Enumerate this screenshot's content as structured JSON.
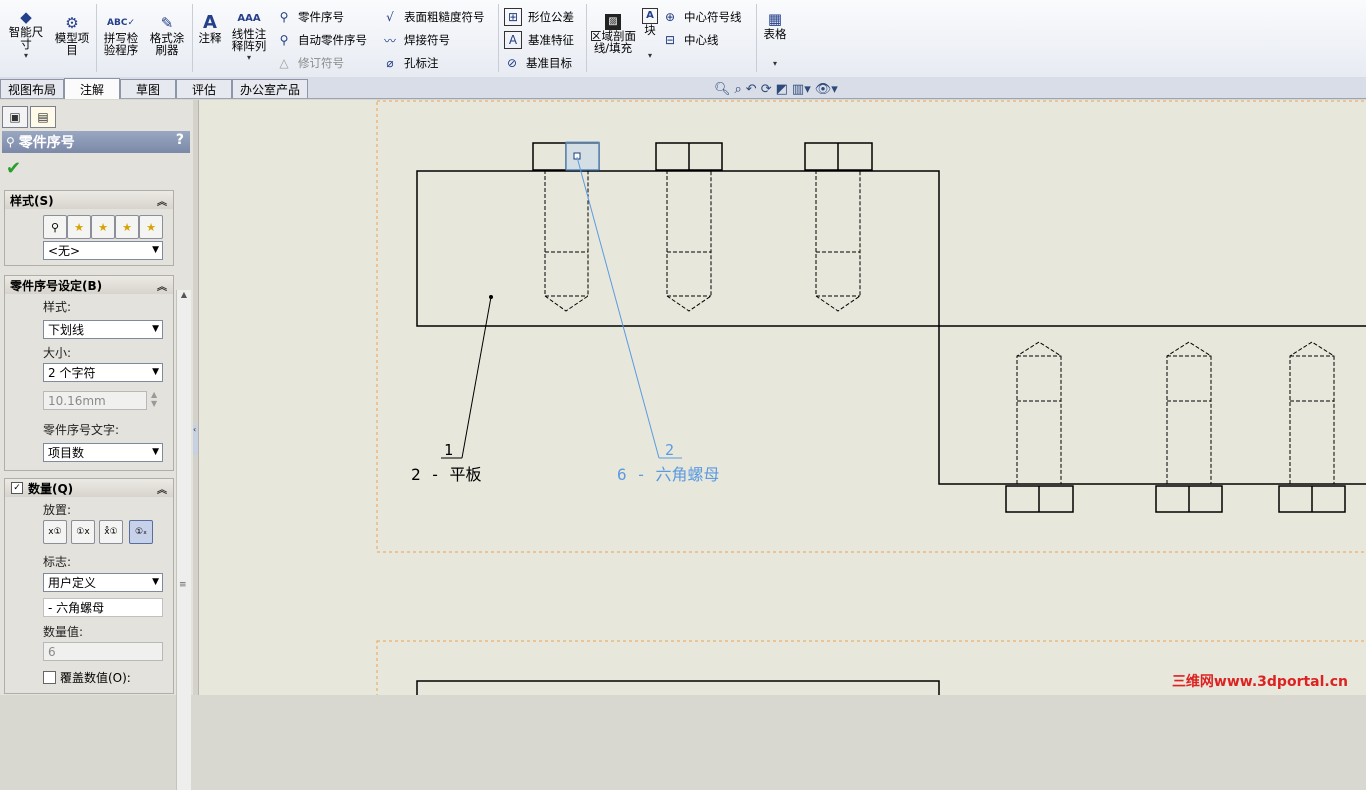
{
  "ribbon": {
    "smart_dim": "智能尺寸",
    "model_items": "模型项目",
    "spell_check": "拼写检验程序",
    "format_painter": "格式涂刷器",
    "note": "注释",
    "linear_pattern": "线性注释阵列",
    "balloon": "零件序号",
    "auto_balloon": "自动零件序号",
    "revision_symbol": "修订符号",
    "surface_finish": "表面粗糙度符号",
    "weld_symbol": "焊接符号",
    "hole_callout": "孔标注",
    "gdt": "形位公差",
    "datum_feature": "基准特征",
    "datum_target": "基准目标",
    "area_hatch": "区域剖面线/填充",
    "block": "块",
    "center_mark": "中心符号线",
    "centerline": "中心线",
    "table": "表格"
  },
  "tabs": [
    "视图布局",
    "注解",
    "草图",
    "评估",
    "办公室产品"
  ],
  "active_tab": "注解",
  "panel": {
    "title": "零件序号",
    "help": "?",
    "style_group": {
      "title": "样式(S)",
      "combo": "<无>"
    },
    "balloon_settings": {
      "title": "零件序号设定(B)",
      "style_label": "样式:",
      "style_value": "下划线",
      "size_label": "大小:",
      "size_value": "2 个字符",
      "custom_size": "10.16mm",
      "text_label": "零件序号文字:",
      "text_value": "项目数"
    },
    "quantity": {
      "title": "数量(Q)",
      "placement_label": "放置:",
      "denotation_label": "标志:",
      "denotation_value": "用户定义",
      "custom_text": "- 六角螺母",
      "value_label": "数量值:",
      "value": "6",
      "override_label": "覆盖数值(O):"
    }
  },
  "drawing": {
    "balloon1": {
      "number": "1",
      "label": "2 - 平板"
    },
    "balloon2": {
      "number": "2",
      "label": "6 - 六角螺母"
    }
  },
  "watermark": "三维网www.3dportal.cn",
  "colors": {
    "selection": "#5b9be0",
    "sheet_border": "#e8a050",
    "canvas": "#e8e7dc"
  }
}
